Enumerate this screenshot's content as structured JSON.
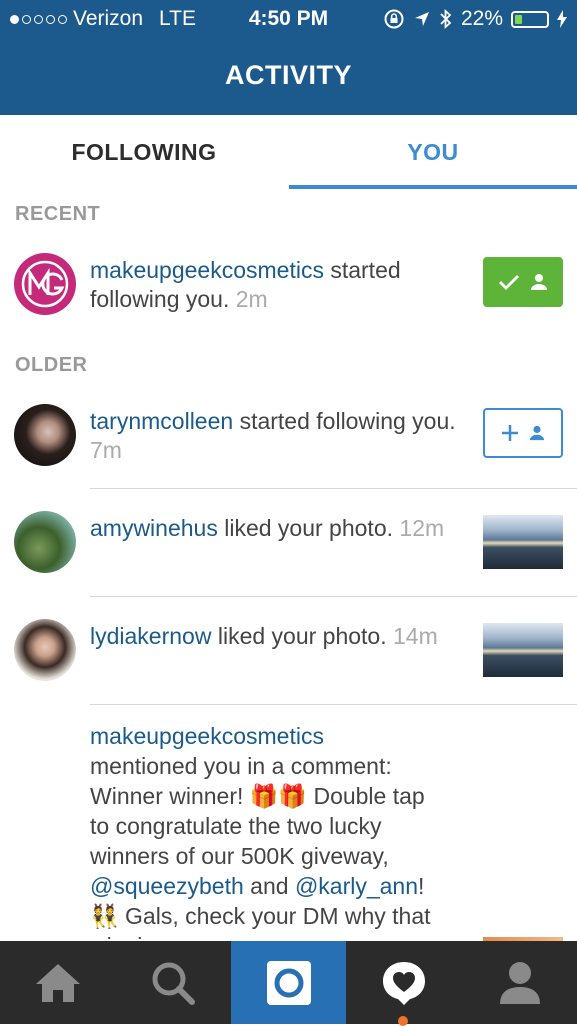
{
  "status_bar": {
    "carrier": "Verizon",
    "network": "LTE",
    "time": "4:50 PM",
    "battery": "22%",
    "battery_level": 0.22
  },
  "header": {
    "title": "ACTIVITY"
  },
  "tabs": [
    {
      "label": "FOLLOWING",
      "active": false
    },
    {
      "label": "YOU",
      "active": true
    }
  ],
  "sections": {
    "recent": "RECENT",
    "older": "OLDER"
  },
  "notifications": [
    {
      "user": "makeupgeekcosmetics",
      "action": " started following you.",
      "time": "2m",
      "control": "following-button"
    },
    {
      "user": "tarynmcolleen",
      "action": " started following you.",
      "time": "7m",
      "control": "follow-button"
    },
    {
      "user": "amywinehus",
      "action": " liked your photo.",
      "time": "12m",
      "control": "photo-thumbnail"
    },
    {
      "user": "lydiakernow",
      "action": " liked your photo.",
      "time": "14m",
      "control": "photo-thumbnail"
    },
    {
      "user": "makeupgeekcosmetics",
      "mention_a": "mentioned you in a comment: Winner winner! ",
      "emoji_gifts": "🎁🎁",
      "mention_b": " Double tap to congratulate the two lucky winners of our 500K giveway, ",
      "tag_1": "@squeezybeth",
      "mention_c": " and ",
      "tag_2": "@karly_ann",
      "mention_d": "! ",
      "emoji_dancers": "👯",
      "mention_e": " Gals, check your DM why that winning"
    }
  ],
  "colors": {
    "brand": "#1c5a8e",
    "accent": "#3d8cd1",
    "username": "#1b5a8a",
    "following_green": "#5db439",
    "navbar": "#2b2b2b",
    "active_nav": "#2770b3"
  },
  "nav_icons": [
    "home-icon",
    "search-icon",
    "camera-icon",
    "activity-heart-icon",
    "profile-icon"
  ]
}
